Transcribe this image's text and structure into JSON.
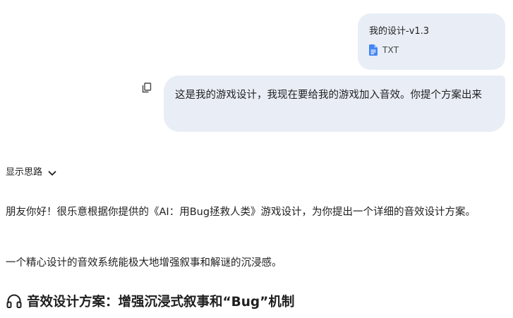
{
  "attachment": {
    "file_name": "我的设计-v1.3",
    "file_type": "TXT",
    "icon": "document-icon",
    "icon_color": "#4285f4"
  },
  "user_message": {
    "text": "这是我的游戏设计，我现在要给我的游戏加入音效。你提个方案出来",
    "bubble_color": "#e9eef6",
    "copy_icon": "copy-icon"
  },
  "thinking": {
    "label": "显示思路",
    "icon": "chevron-down-icon"
  },
  "response": {
    "paragraph_1": "朋友你好！很乐意根据你提供的《AI：用Bug拯救人类》游戏设计，为你提出一个详细的音效设计方案。",
    "paragraph_2": "一个精心设计的音效系统能极大地增强叙事和解谜的沉浸感。",
    "heading": "音效设计方案：增强沉浸式叙事和“Bug”机制",
    "heading_icon": "headphones-icon"
  }
}
